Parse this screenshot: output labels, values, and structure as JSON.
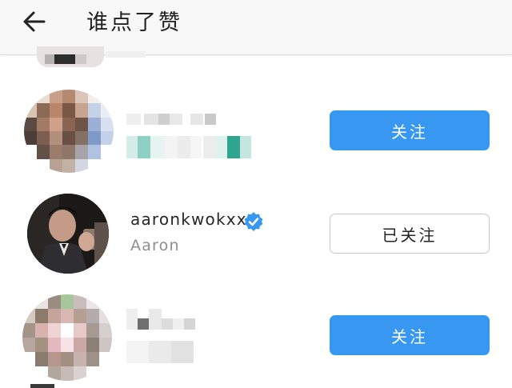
{
  "header": {
    "title": "谁点了赞",
    "back_icon": "arrow-left-icon"
  },
  "likers": [
    {
      "username": "",
      "full_name": "",
      "button": "关注",
      "button_state": "follow",
      "blurred": true
    },
    {
      "username": "aaronkwokxx",
      "full_name": "Aaron",
      "verified": true,
      "button": "已关注",
      "button_state": "following",
      "blurred": false
    },
    {
      "username": "",
      "full_name": "",
      "button": "关注",
      "button_state": "follow",
      "blurred": true
    }
  ],
  "colors": {
    "accent": "#3897f0",
    "verified_badge": "#3897f0",
    "secondary_text": "#8e8e8e"
  }
}
